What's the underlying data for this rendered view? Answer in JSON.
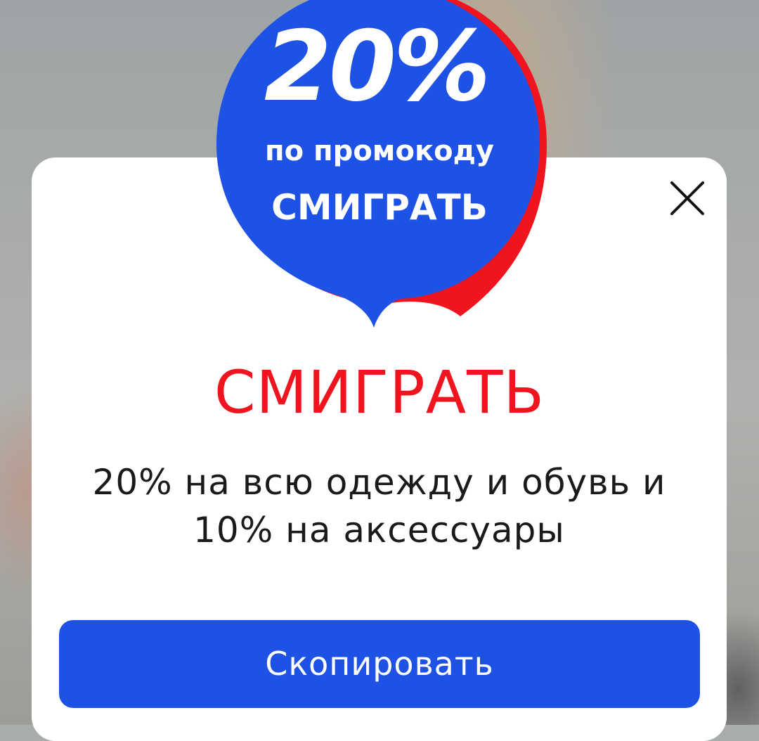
{
  "badge": {
    "discount": "20%",
    "subtitle": "по промокоду",
    "code": "СМИГРАТЬ",
    "colors": {
      "blue": "#1d52e5",
      "red": "#f0141e"
    }
  },
  "promo": {
    "title": "СМИГРАТЬ",
    "description_line1": "20% на всю одежду и обувь и",
    "description_line2": "10% на аксессуары"
  },
  "actions": {
    "copy_label": "Скопировать",
    "close_icon": "close-icon"
  }
}
